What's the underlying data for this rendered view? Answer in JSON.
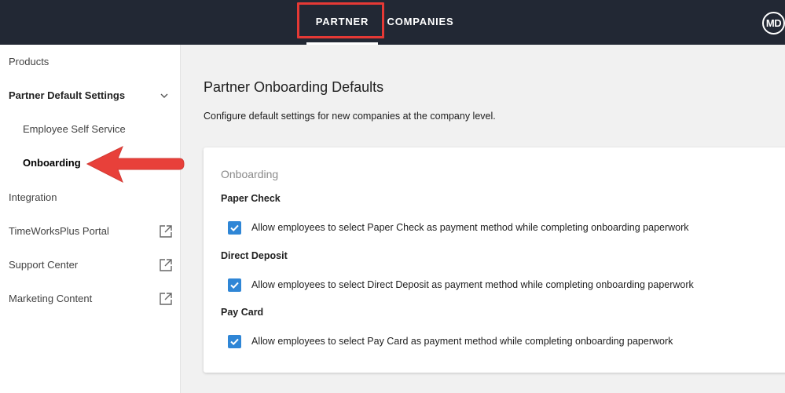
{
  "header": {
    "tabs": [
      {
        "label": "PARTNER",
        "active": true
      },
      {
        "label": "COMPANIES",
        "active": false
      }
    ],
    "avatar_initials": "MD",
    "bar_color": "#222834",
    "highlight_color": "#e53935"
  },
  "sidebar": {
    "items": [
      {
        "label": "Products"
      },
      {
        "label": "Partner Default Settings",
        "icon": "chevron-down-icon",
        "expanded": true
      },
      {
        "label": "Employee Self Service"
      },
      {
        "label": "Onboarding",
        "active": true
      },
      {
        "label": "Integration"
      },
      {
        "label": "TimeWorksPlus Portal",
        "icon": "external-link-icon"
      },
      {
        "label": "Support Center",
        "icon": "external-link-icon"
      },
      {
        "label": "Marketing Content",
        "icon": "external-link-icon"
      }
    ]
  },
  "main": {
    "title": "Partner Onboarding Defaults",
    "description": "Configure default settings for new companies at the company level.",
    "card": {
      "section_title": "Onboarding",
      "groups": [
        {
          "label": "Paper Check",
          "checkbox_label": "Allow employees to select Paper Check as payment method while completing onboarding paperwork",
          "checked": true
        },
        {
          "label": "Direct Deposit",
          "checkbox_label": "Allow employees to select Direct Deposit as payment method while completing onboarding paperwork",
          "checked": true
        },
        {
          "label": "Pay Card",
          "checkbox_label": "Allow employees to select Pay Card as payment method while completing onboarding paperwork",
          "checked": true
        }
      ]
    },
    "accent_color": "#2f86d6"
  }
}
